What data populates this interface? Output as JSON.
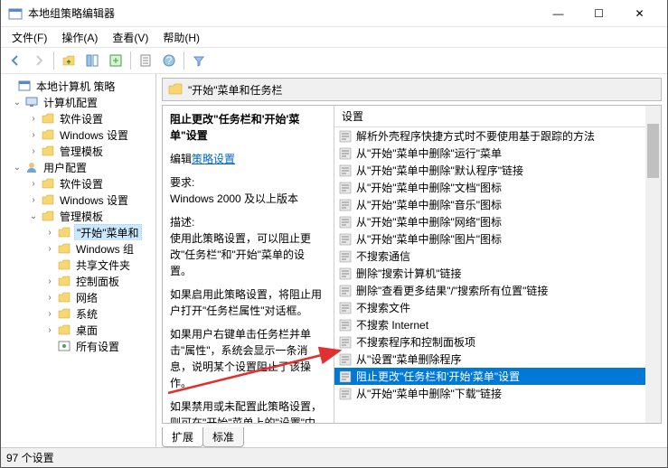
{
  "window": {
    "title": "本地组策略编辑器",
    "min": "—",
    "max": "☐",
    "close": "✕"
  },
  "menu": {
    "file": "文件(F)",
    "action": "操作(A)",
    "view": "查看(V)",
    "help": "帮助(H)"
  },
  "tree": {
    "root": "本地计算机 策略",
    "comp": "计算机配置",
    "comp_software": "软件设置",
    "comp_windows": "Windows 设置",
    "comp_admin": "管理模板",
    "user": "用户配置",
    "user_software": "软件设置",
    "user_windows": "Windows 设置",
    "user_admin": "管理模板",
    "start_menu": "\"开始\"菜单和",
    "windows_comp": "Windows 组",
    "shared": "共享文件夹",
    "control_panel": "控制面板",
    "network": "网络",
    "system": "系统",
    "desktop": "桌面",
    "all_settings": "所有设置"
  },
  "path": "\"开始\"菜单和任务栏",
  "desc": {
    "title": "阻止更改\"任务栏和'开始'菜单\"设置",
    "edit_label": "编辑",
    "policy_link": "策略设置",
    "req_label": "要求:",
    "req_text": "Windows 2000 及以上版本",
    "descr_label": "描述:",
    "descr_text": "使用此策略设置，可以阻止更改\"任务栏\"和\"开始\"菜单的设置。",
    "p2": "如果启用此策略设置，将阻止用户打开\"任务栏属性\"对话框。",
    "p3": "如果用户右键单击任务栏并单击\"属性\"，系统会显示一条消息，说明某个设置阻止了该操作。",
    "p4": "如果禁用或未配置此策略设置，则可在\"开始\"菜单上的\"设置\"中显示\"任务栏\"和\"开始\"菜单项。"
  },
  "list": {
    "header": "设置",
    "items": [
      "解析外壳程序快捷方式时不要使用基于跟踪的方法",
      "从\"开始\"菜单中删除\"运行\"菜单",
      "从\"开始\"菜单中删除\"默认程序\"链接",
      "从\"开始\"菜单中删除\"文档\"图标",
      "从\"开始\"菜单中删除\"音乐\"图标",
      "从\"开始\"菜单中删除\"网络\"图标",
      "从\"开始\"菜单中删除\"图片\"图标",
      "不搜索通信",
      "删除\"搜索计算机\"链接",
      "删除\"查看更多结果\"/\"搜索所有位置\"链接",
      "不搜索文件",
      "不搜索 Internet",
      "不搜索程序和控制面板项",
      "从\"设置\"菜单删除程序",
      "阻止更改\"任务栏和'开始'菜单\"设置",
      "从\"开始\"菜单中删除\"下载\"链接"
    ],
    "selected_index": 14
  },
  "tabs": {
    "ext": "扩展",
    "std": "标准"
  },
  "status": "97 个设置"
}
